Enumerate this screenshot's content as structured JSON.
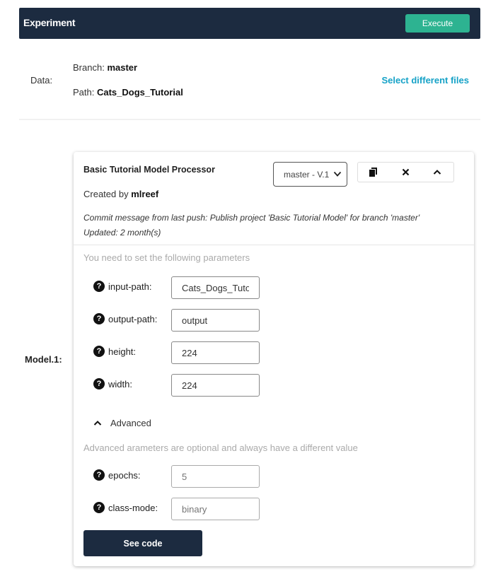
{
  "header": {
    "title": "Experiment",
    "execute_label": "Execute"
  },
  "data_section": {
    "label": "Data:",
    "branch_label": "Branch:",
    "branch_value": "master",
    "path_label": "Path:",
    "path_value": "Cats_Dogs_Tutorial",
    "select_files_label": "Select different files"
  },
  "model": {
    "label": "Model.1:",
    "title": "Basic Tutorial Model Processor",
    "created_by_label": "Created by",
    "created_by_value": "mlreef",
    "version_selected": "master - V.1",
    "commit_message": "Commit message from last push: Publish project 'Basic Tutorial Model' for branch 'master'",
    "updated": "Updated: 2 month(s)",
    "params_hint": "You need to set the following parameters",
    "params": [
      {
        "label": "input-path:",
        "value": "Cats_Dogs_Tutorial"
      },
      {
        "label": "output-path:",
        "value": "output"
      },
      {
        "label": "height:",
        "value": "224"
      },
      {
        "label": "width:",
        "value": "224"
      }
    ],
    "advanced_label": "Advanced",
    "advanced_hint": "Advanced arameters are optional and always have a different value",
    "advanced_params": [
      {
        "label": "epochs:",
        "placeholder": "5"
      },
      {
        "label": "class-mode:",
        "placeholder": "binary"
      }
    ],
    "see_code_label": "See code"
  }
}
